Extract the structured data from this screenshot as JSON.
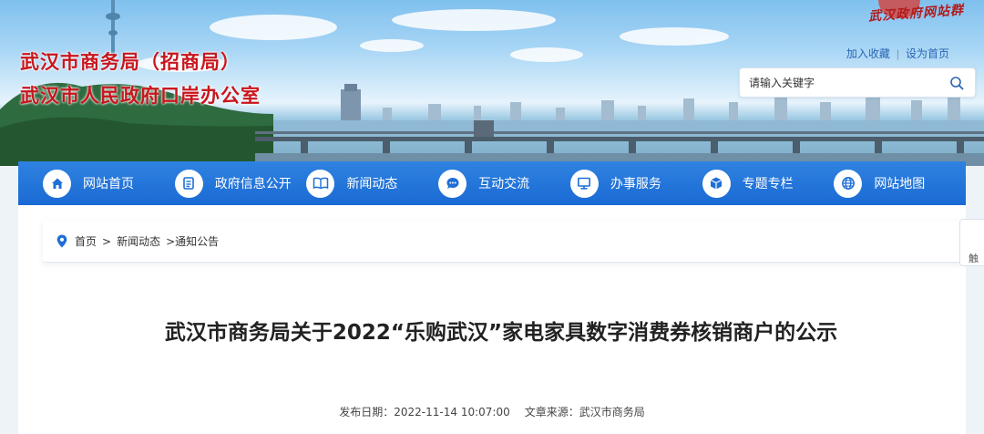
{
  "header": {
    "title_line1": "武汉市商务局（招商局）",
    "title_line2": "武汉市人民政府口岸办公室",
    "seal_text": "武汉政府网站群",
    "links": {
      "favorite": "加入收藏",
      "homepage": "设为首页"
    },
    "search": {
      "placeholder": "请输入关键字",
      "value": ""
    }
  },
  "nav": {
    "items": [
      {
        "label": "网站首页",
        "icon": "home-icon"
      },
      {
        "label": "政府信息公开",
        "icon": "document-icon"
      },
      {
        "label": "新闻动态",
        "icon": "book-icon"
      },
      {
        "label": "互动交流",
        "icon": "chat-icon"
      },
      {
        "label": "办事服务",
        "icon": "monitor-icon"
      },
      {
        "label": "专题专栏",
        "icon": "box-icon"
      },
      {
        "label": "网站地图",
        "icon": "globe-icon"
      }
    ]
  },
  "breadcrumb": {
    "items": [
      "首页",
      "新闻动态",
      "通知公告"
    ],
    "separator": ">"
  },
  "article": {
    "title": "武汉市商务局关于2022“乐购武汉”家电家具数字消费券核销商户的公示",
    "publish_label": "发布日期：",
    "publish_date": "2022-11-14 10:07:00",
    "source_label": "文章来源：",
    "source": "武汉市商务局"
  },
  "side_float": {
    "label": "触"
  },
  "colors": {
    "title_red": "#c8161d",
    "nav_blue": "#1f72d8",
    "link_blue": "#2a66b5"
  }
}
